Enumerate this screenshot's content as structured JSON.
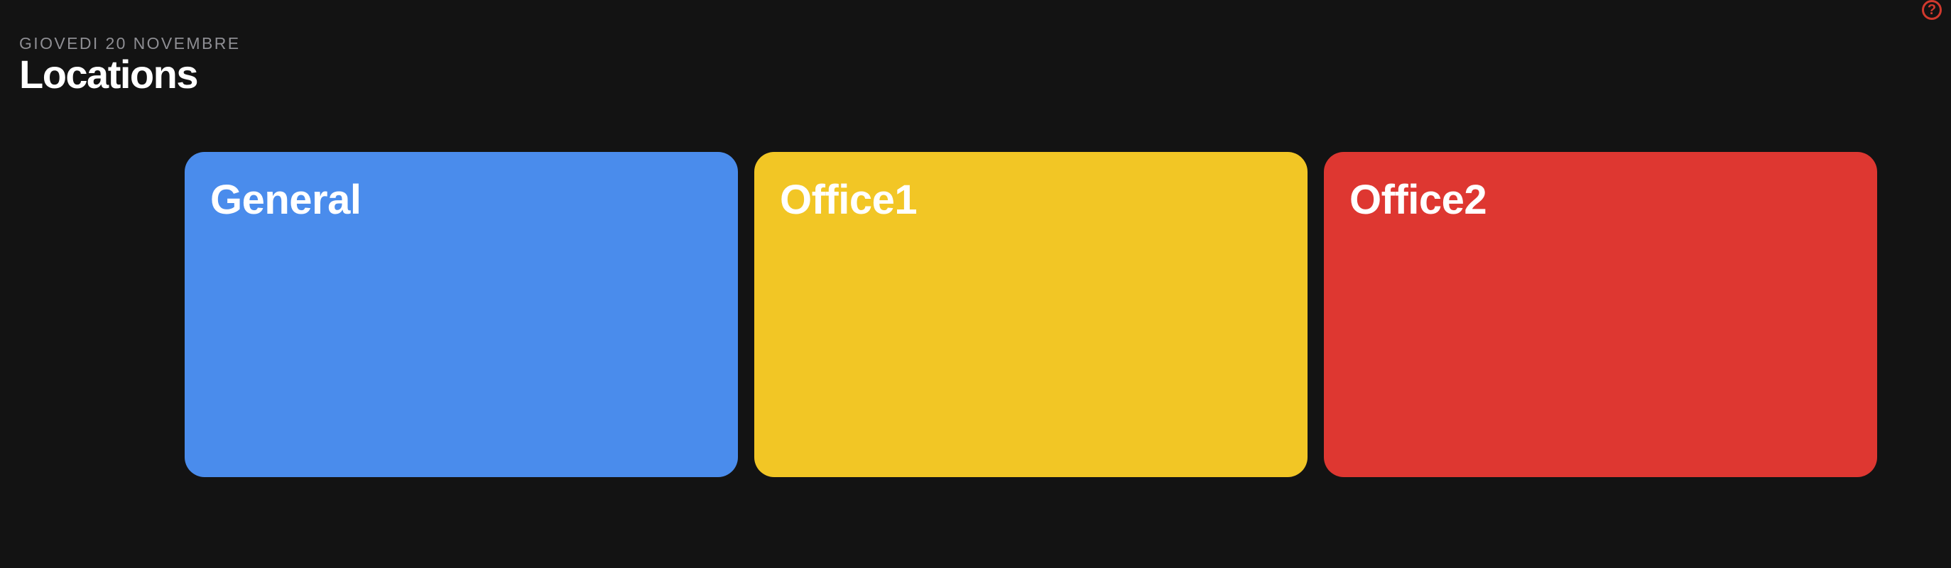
{
  "header": {
    "date": "GIOVEDI 20 NOVEMBRE",
    "title": "Locations"
  },
  "help": {
    "glyph": "?",
    "icon": "question-circle-icon",
    "color": "#d0392d"
  },
  "locations": [
    {
      "label": "General",
      "color": "#4a8cec"
    },
    {
      "label": "Office1",
      "color": "#f2c625"
    },
    {
      "label": "Office2",
      "color": "#de3731"
    }
  ]
}
